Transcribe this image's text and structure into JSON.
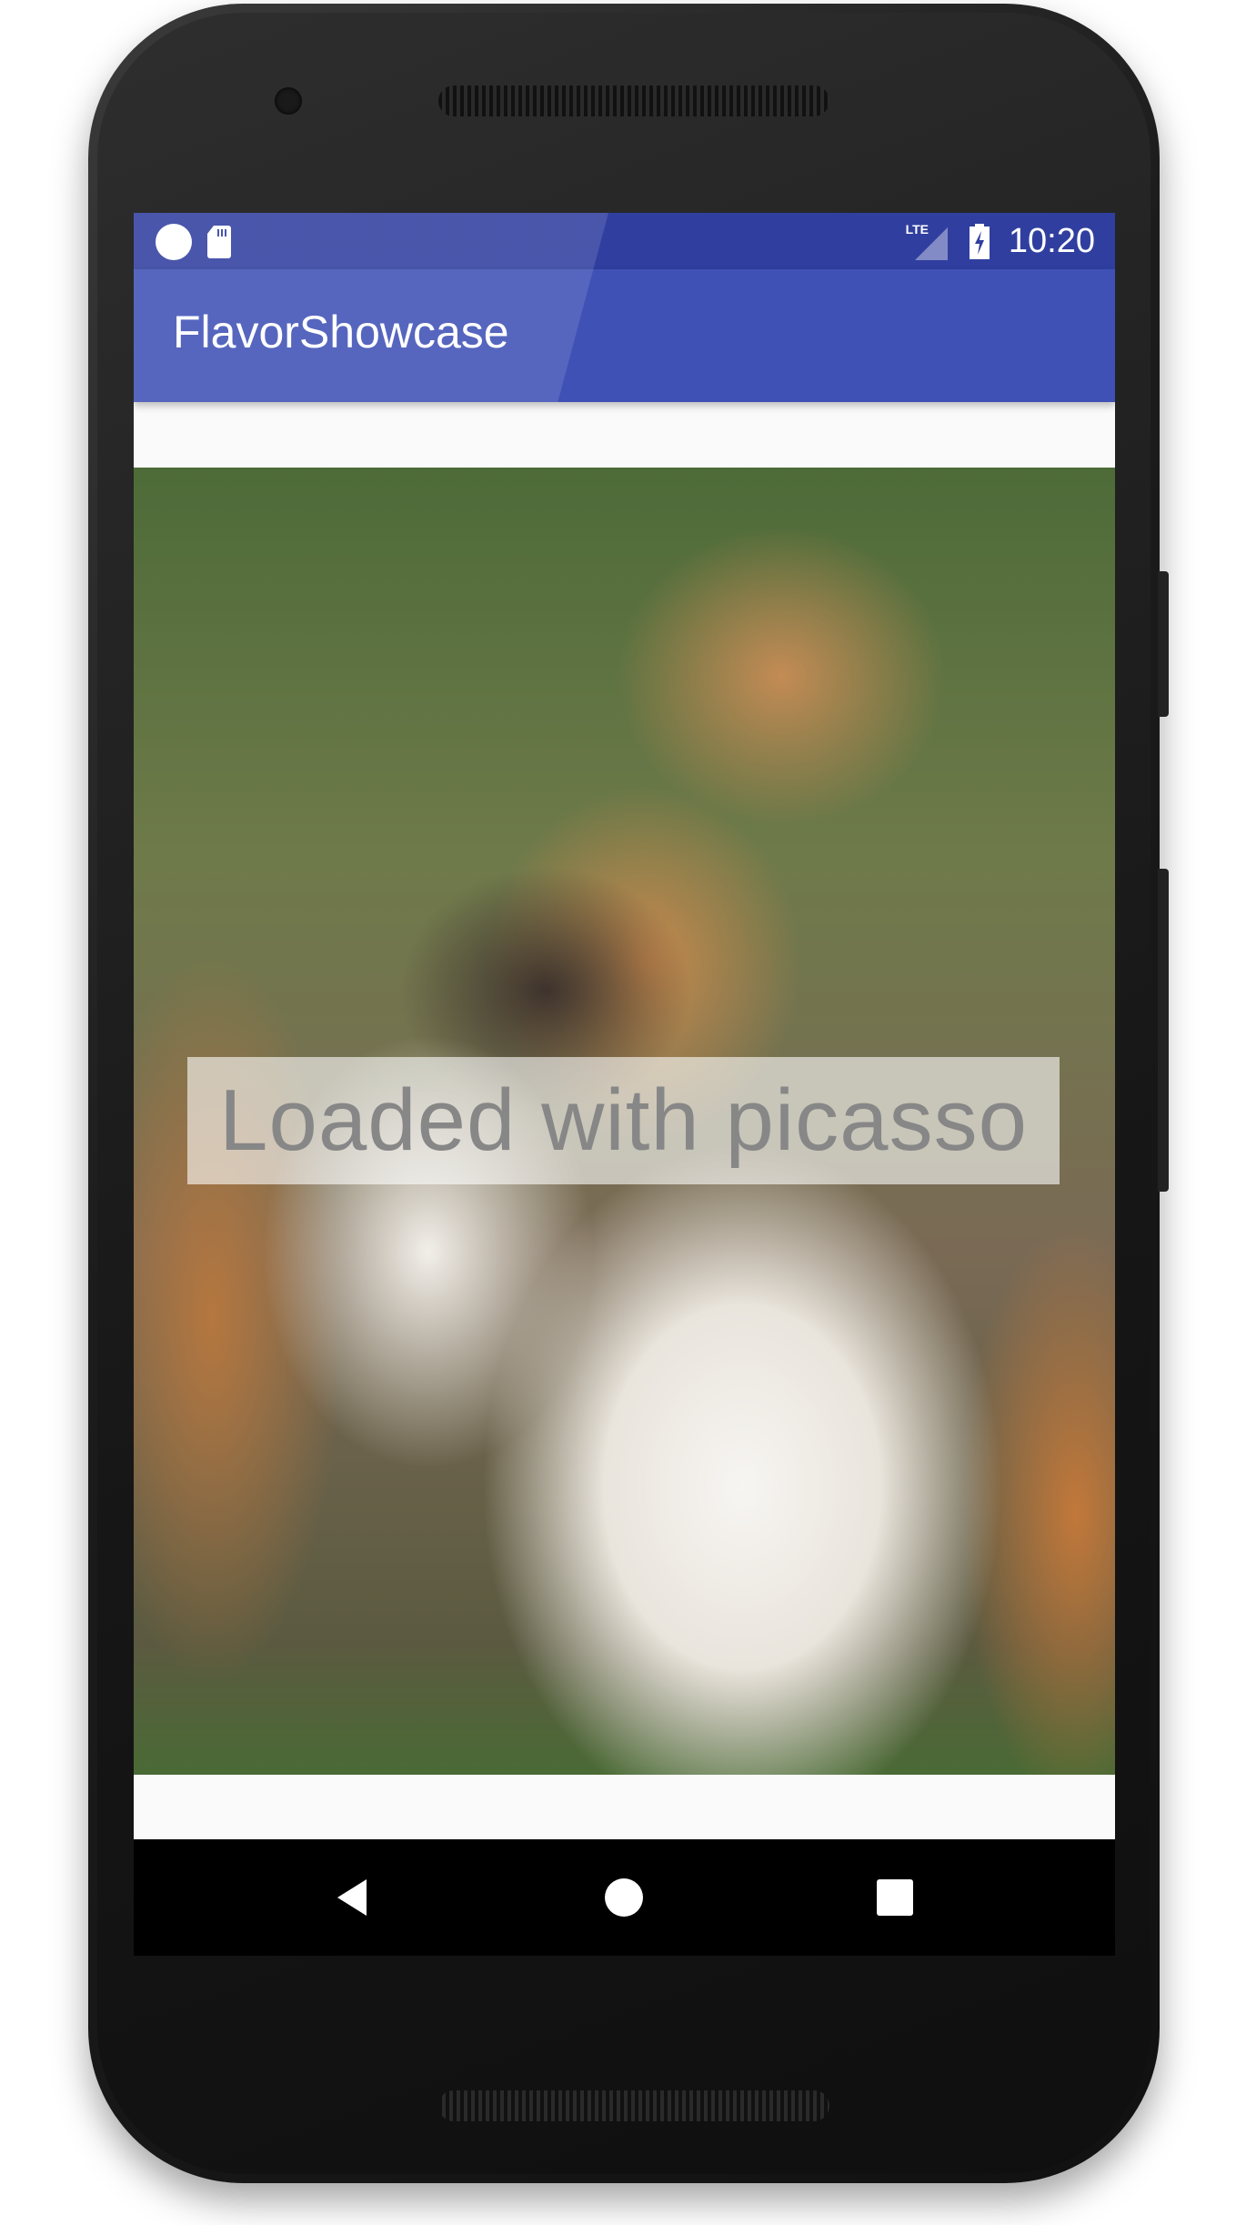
{
  "status_bar": {
    "time": "10:20",
    "network": "LTE"
  },
  "app_bar": {
    "title": "FlavorShowcase"
  },
  "content": {
    "caption": "Loaded with picasso"
  },
  "nav_bar": {
    "buttons": [
      "back",
      "home",
      "recents"
    ]
  },
  "colors": {
    "primary": "#3f51b5",
    "primary_dark": "#303f9f",
    "caption_text": "#878787"
  }
}
